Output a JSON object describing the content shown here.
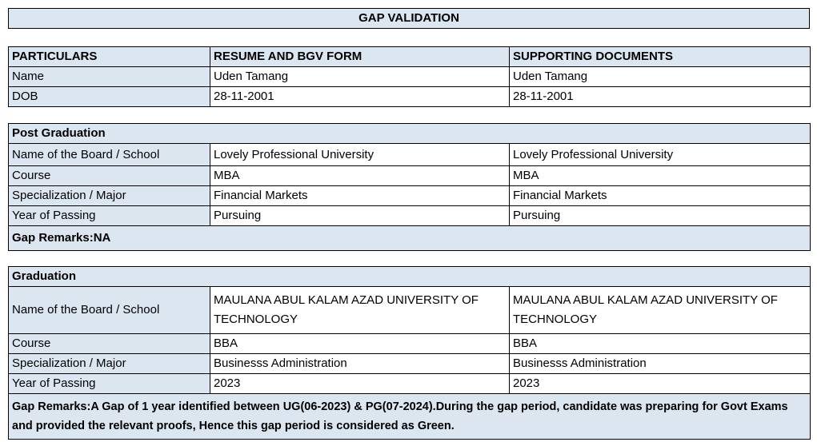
{
  "title": "GAP VALIDATION",
  "header": {
    "col1": "PARTICULARS",
    "col2": "RESUME AND BGV FORM",
    "col3": "SUPPORTING DOCUMENTS"
  },
  "personal": [
    {
      "label": "Name",
      "resume": "Uden Tamang",
      "docs": "Uden Tamang"
    },
    {
      "label": "DOB",
      "resume": "28-11-2001",
      "docs": "28-11-2001"
    }
  ],
  "post_graduation": {
    "heading": "Post Graduation",
    "rows": [
      {
        "label": "Name of the Board / School",
        "resume": "Lovely Professional University",
        "docs": "Lovely Professional University"
      },
      {
        "label": "Course",
        "resume": "MBA",
        "docs": "MBA"
      },
      {
        "label": "Specialization / Major",
        "resume": "Financial Markets",
        "docs": "Financial Markets"
      },
      {
        "label": "Year of Passing",
        "resume": "Pursuing",
        "docs": "Pursuing"
      }
    ],
    "remarks": "Gap Remarks:NA"
  },
  "graduation": {
    "heading": "Graduation",
    "rows": [
      {
        "label": "Name of the Board / School",
        "resume": "MAULANA ABUL KALAM AZAD UNIVERSITY OF TECHNOLOGY",
        "docs": "MAULANA ABUL KALAM AZAD UNIVERSITY OF TECHNOLOGY"
      },
      {
        "label": "Course",
        "resume": "BBA",
        "docs": "BBA"
      },
      {
        "label": "Specialization / Major",
        "resume": "Businesss Administration",
        "docs": "Businesss Administration"
      },
      {
        "label": "Year of Passing",
        "resume": "2023",
        "docs": "2023"
      }
    ],
    "remarks": "Gap Remarks:A Gap of 1 year identified between UG(06-2023) & PG(07-2024).During the gap period, candidate was preparing for Govt Exams and provided the relevant proofs, Hence this gap period is considered as Green."
  }
}
